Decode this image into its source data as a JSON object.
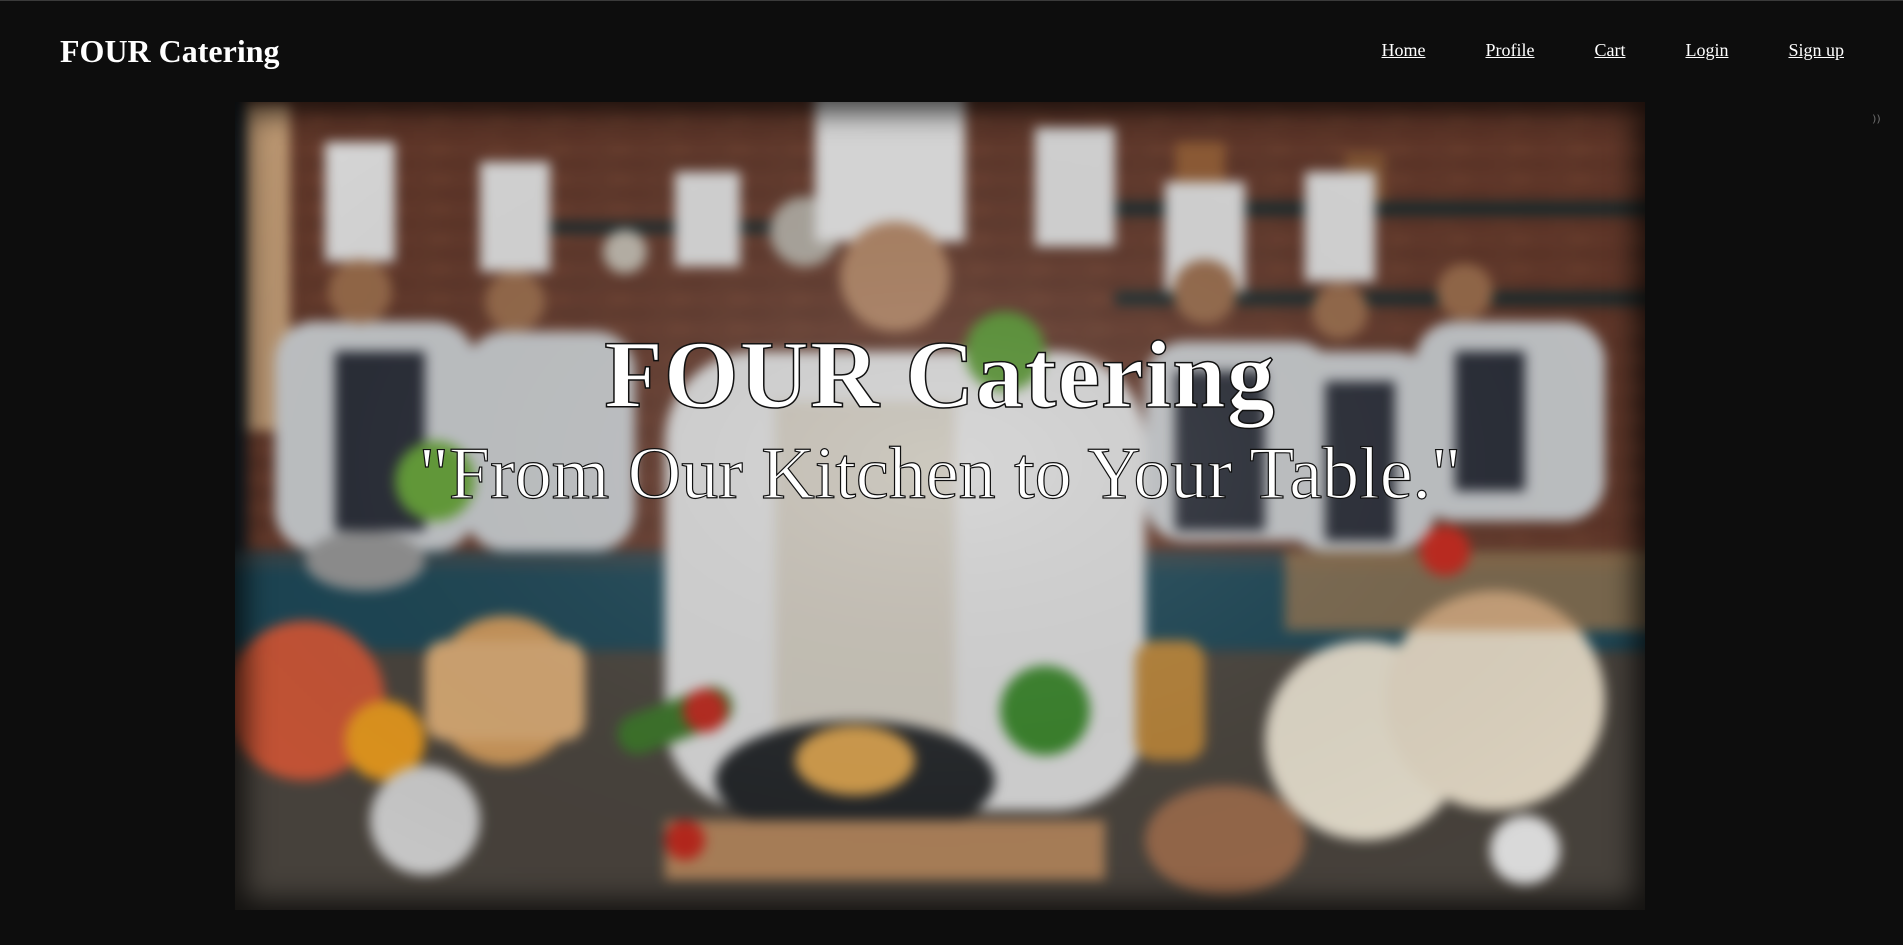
{
  "header": {
    "brand": "FOUR Catering",
    "nav": {
      "home": "Home",
      "profile": "Profile",
      "cart": "Cart",
      "login": "Login",
      "signup": "Sign up"
    }
  },
  "hero": {
    "title": "FOUR Catering",
    "tagline": "\"From Our Kitchen to Your Table.\"",
    "image_icon": "kitchen-chefs-photo"
  },
  "colors": {
    "background": "#0d0d0d",
    "text": "#ffffff"
  }
}
